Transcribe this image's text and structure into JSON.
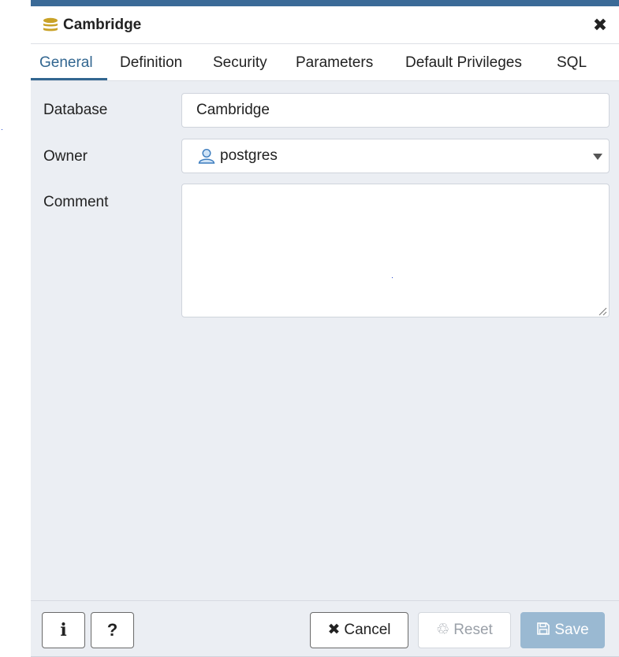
{
  "dialog": {
    "title": "Cambridge",
    "close_glyph": "✖",
    "icons": {
      "title": "database-icon",
      "close": "close-icon"
    },
    "colors": {
      "accent": "#326690",
      "title_bar": "#3b6a97",
      "save_disabled": "#9ab9d2",
      "database_icon": "#c9a227"
    }
  },
  "tabs": [
    {
      "label": "General",
      "active": true
    },
    {
      "label": "Definition",
      "active": false
    },
    {
      "label": "Security",
      "active": false
    },
    {
      "label": "Parameters",
      "active": false
    },
    {
      "label": "Default Privileges",
      "active": false
    },
    {
      "label": "SQL",
      "active": false
    }
  ],
  "form": {
    "database": {
      "label": "Database",
      "value": "Cambridge"
    },
    "owner": {
      "label": "Owner",
      "value": "postgres",
      "icon": "user-icon"
    },
    "comment": {
      "label": "Comment",
      "value": ""
    }
  },
  "footer": {
    "info_glyph": "i",
    "help_glyph": "?",
    "cancel": {
      "label": "Cancel",
      "glyph": "✖",
      "icon": "close-icon"
    },
    "reset": {
      "label": "Reset",
      "glyph": "♲",
      "icon": "recycle-icon",
      "disabled": true
    },
    "save": {
      "label": "Save",
      "glyph": "🖫",
      "icon": "floppy-disk-icon",
      "disabled": true
    }
  }
}
